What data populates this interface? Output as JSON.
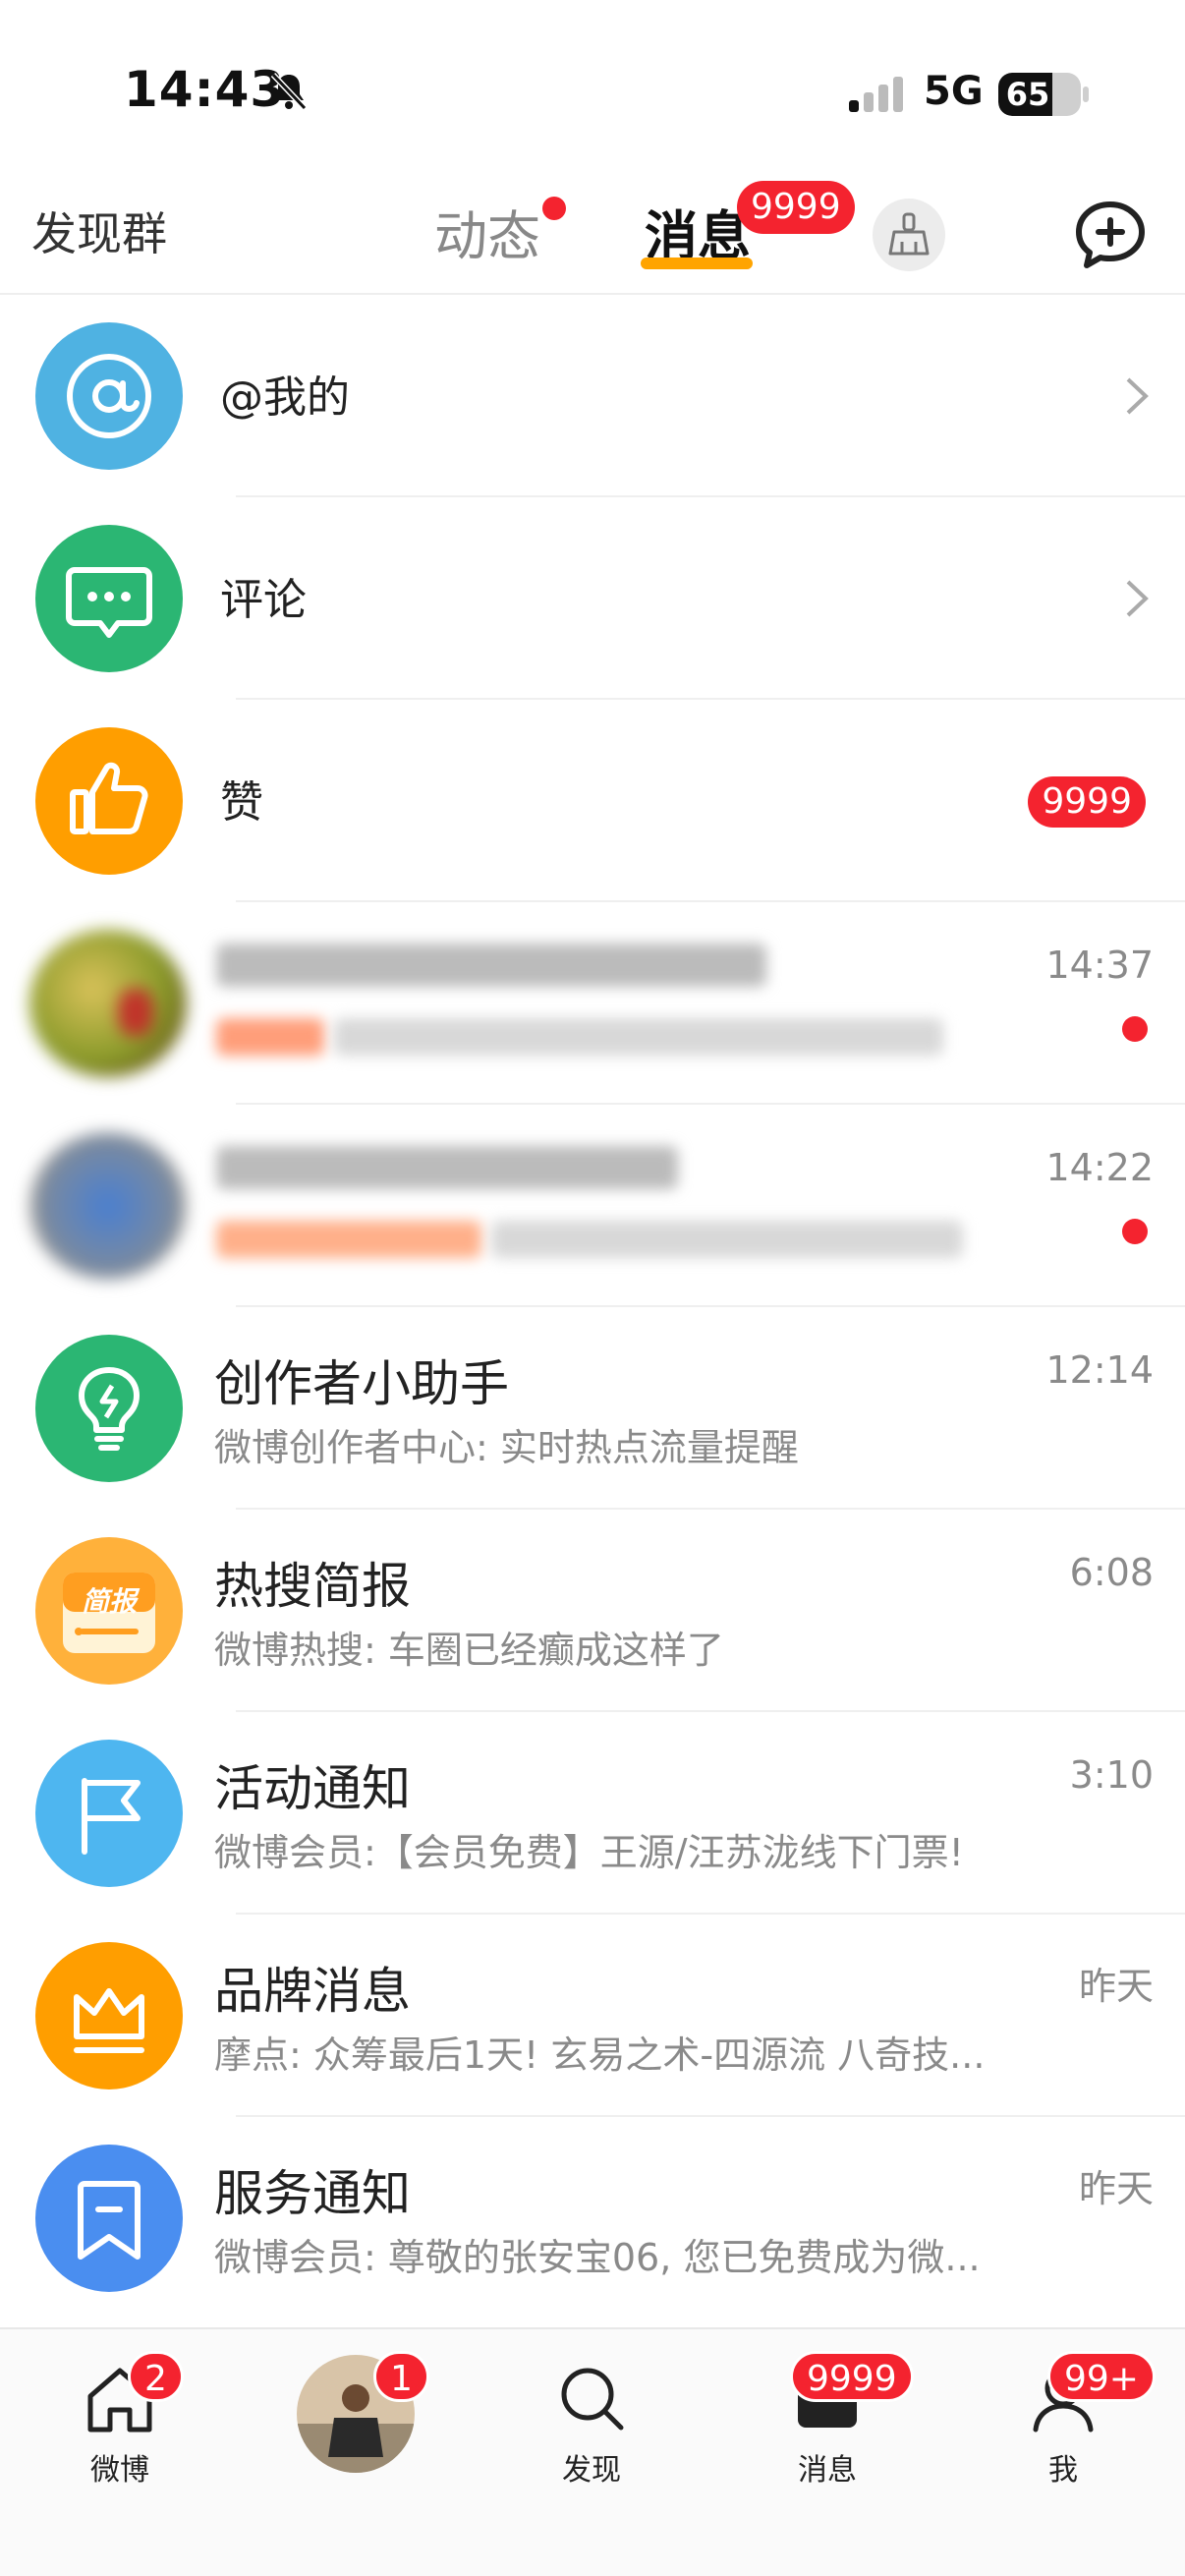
{
  "status_bar": {
    "time": "14:43",
    "network": "5G",
    "battery": "65",
    "battery_level": 0.65
  },
  "header": {
    "left_link": "发现群",
    "tabs": [
      {
        "label": "动态"
      },
      {
        "label": "消息",
        "badge": "9999"
      }
    ]
  },
  "list": {
    "mentions": {
      "label": "@我的"
    },
    "comments": {
      "label": "评论"
    },
    "likes": {
      "label": "赞",
      "badge": "9999"
    },
    "blurred": [
      {
        "time": "14:37"
      },
      {
        "time": "14:22"
      }
    ],
    "items": [
      {
        "title": "创作者小助手",
        "subtitle": "微博创作者中心: 实时热点流量提醒",
        "time": "12:14",
        "icon": "lightbulb-icon",
        "color": "#2bb673"
      },
      {
        "title": "热搜简报",
        "subtitle": "微博热搜: 车圈已经癫成这样了",
        "time": "6:08",
        "icon": "news-brief-icon",
        "color": "#ffb13b",
        "icon_text": "简报"
      },
      {
        "title": "活动通知",
        "subtitle": "微博会员:【会员免费】王源/汪苏泷线下门票!",
        "time": "3:10",
        "icon": "flag-icon",
        "color": "#4eb6f0"
      },
      {
        "title": "品牌消息",
        "subtitle": "摩点: 众筹最后1天! 玄易之术-四源流 八奇技...",
        "time": "昨天",
        "icon": "crown-icon",
        "color": "#ff9e00"
      },
      {
        "title": "服务通知",
        "subtitle": "微博会员: 尊敬的张安宝06, 您已免费成为微...",
        "time": "昨天",
        "icon": "bookmark-icon",
        "color": "#4a8ef0"
      }
    ]
  },
  "tabbar": {
    "items": [
      {
        "label": "微博",
        "badge": "2",
        "icon": "home-icon"
      },
      {
        "label": "",
        "badge": "1",
        "icon": "user-avatar"
      },
      {
        "label": "发现",
        "badge": "",
        "icon": "search-icon"
      },
      {
        "label": "消息",
        "badge": "9999",
        "icon": "message-icon"
      },
      {
        "label": "我",
        "badge": "99+",
        "icon": "profile-icon"
      }
    ]
  },
  "colors": {
    "accent_red": "#f4232f",
    "tab_underline": "#ffa400",
    "mention_blue": "#4fb2e2",
    "comment_green": "#2bb673",
    "like_orange": "#ff9e00"
  }
}
